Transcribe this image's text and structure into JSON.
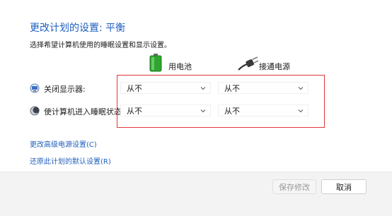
{
  "page": {
    "title": "更改计划的设置: 平衡",
    "subtitle": "选择希望计算机使用的睡眠设置和显示设置。"
  },
  "columns": {
    "battery": {
      "label": "用电池",
      "icon": "battery-icon"
    },
    "plugged": {
      "label": "接通电源",
      "icon": "power-plug-icon"
    }
  },
  "settings": [
    {
      "label": "关闭显示器:",
      "icon": "display-off-icon",
      "battery_value": "从不",
      "plugged_value": "从不"
    },
    {
      "label": "使计算机进入睡眠状态:",
      "icon": "sleep-moon-icon",
      "battery_value": "从不",
      "plugged_value": "从不"
    }
  ],
  "links": {
    "advanced": "更改高级电源设置(C)",
    "restore": "还原此计划的默认设置(R)"
  },
  "buttons": {
    "save": "保存修改",
    "cancel": "取消"
  },
  "colors": {
    "accent": "#1f5fbf",
    "highlight_border": "#e0373b",
    "battery_green": "#3fbf3f"
  }
}
